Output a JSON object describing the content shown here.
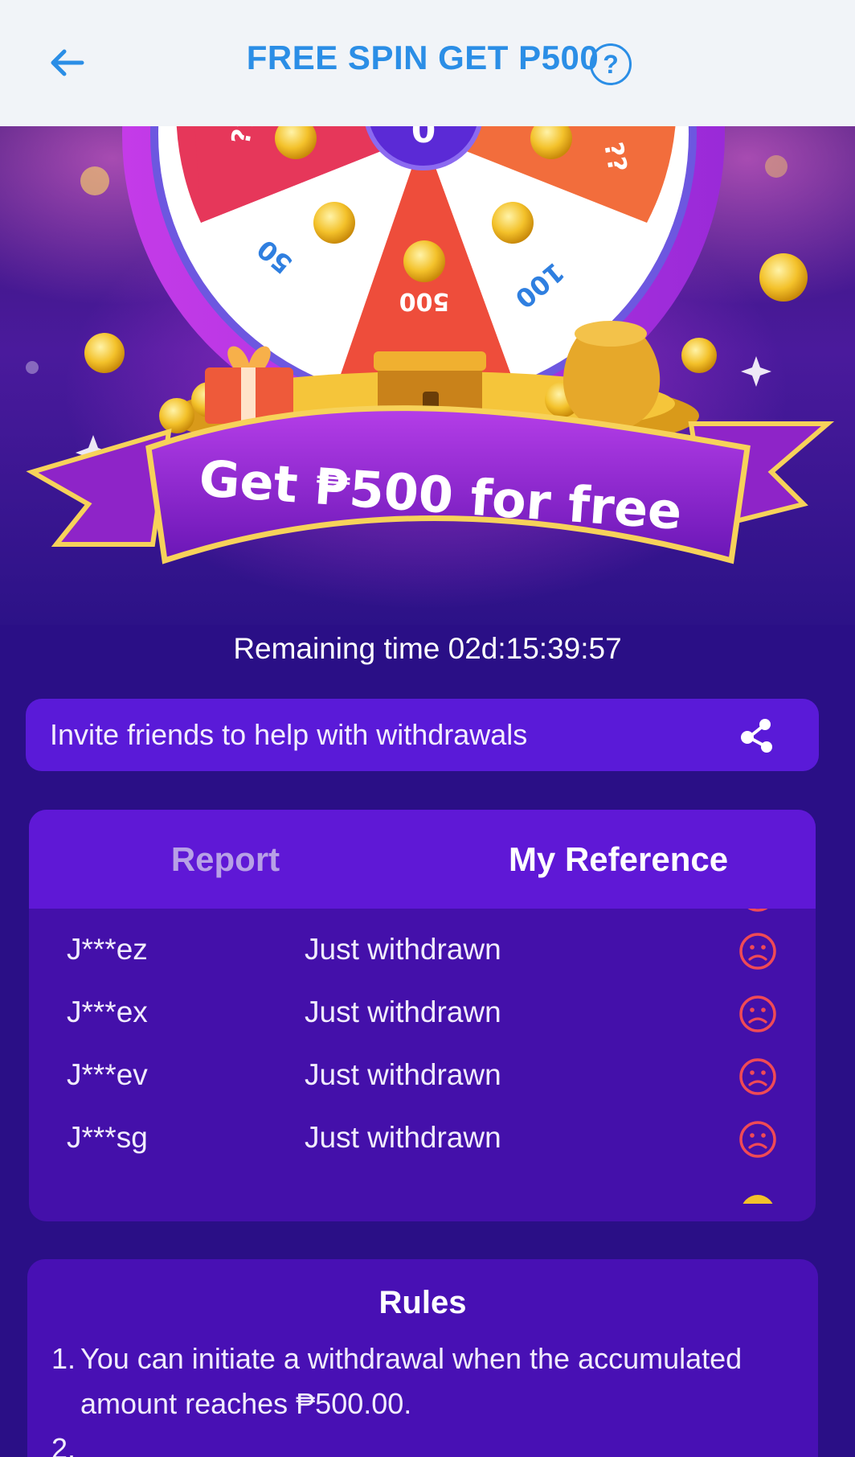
{
  "header": {
    "title": "FREE SPIN GET P500",
    "help_label": "?"
  },
  "hero": {
    "banner_text": "Get ₱500 for free",
    "wheel_labels": [
      "??",
      "??",
      "50",
      "500",
      "100"
    ],
    "center_label": "0"
  },
  "remaining_time": "Remaining time 02d:15:39:57",
  "invite": {
    "label": "Invite friends to help with withdrawals"
  },
  "tabs": [
    {
      "label": "Report",
      "active": false
    },
    {
      "label": "My Reference",
      "active": true
    }
  ],
  "list": [
    {
      "name": "J***ez",
      "status": "Just withdrawn"
    },
    {
      "name": "J***ex",
      "status": "Just withdrawn"
    },
    {
      "name": "J***ev",
      "status": "Just withdrawn"
    },
    {
      "name": "J***sg",
      "status": "Just withdrawn"
    }
  ],
  "rules": {
    "title": "Rules",
    "items": [
      {
        "num": "1.",
        "text": "You can initiate a withdrawal when the accumulated amount reaches ₱500.00."
      },
      {
        "num": "2.",
        "text": ""
      }
    ]
  },
  "colors": {
    "header_bg": "#f1f4f8",
    "accent_blue": "#2b8ee6",
    "page_bg": "#2a0f86",
    "tab_bar": "#5f18d6",
    "sad_icon": "#f04a55"
  }
}
